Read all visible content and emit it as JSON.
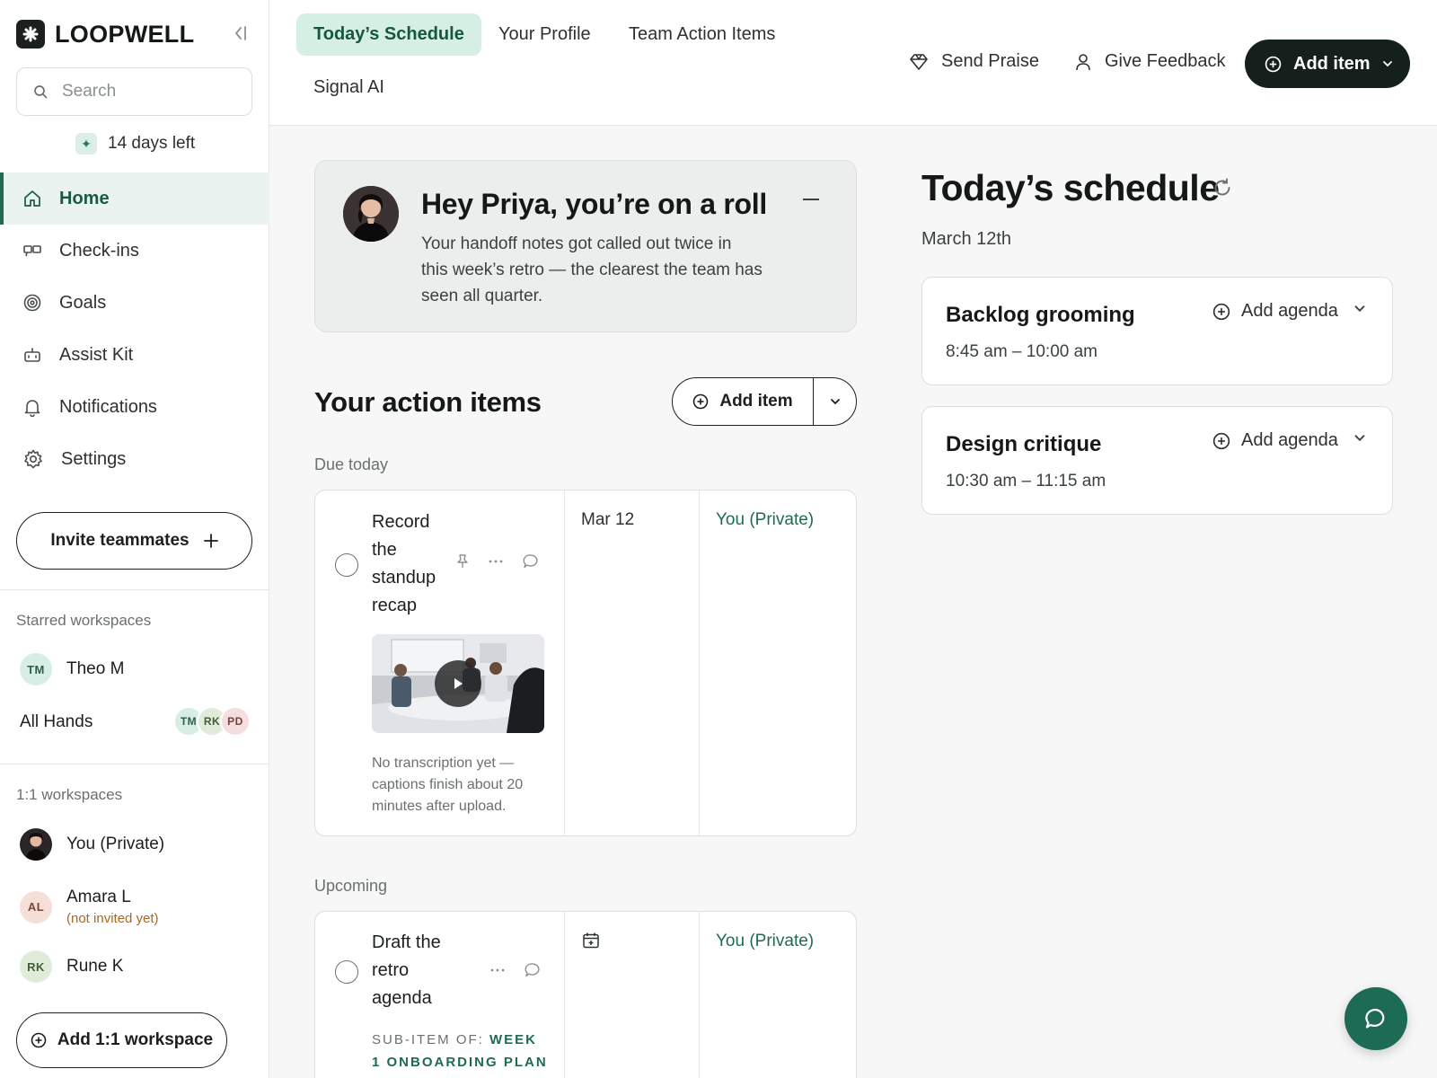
{
  "app": {
    "brand": "LOOPWELL",
    "trial": "14 days left",
    "accent": "#1f6b51",
    "fab_color": "#1e6b55"
  },
  "search": {
    "placeholder": "Search"
  },
  "sidebar": {
    "nav": [
      {
        "label": "Home",
        "icon": "home-icon",
        "active": true
      },
      {
        "label": "Check-ins",
        "icon": "check-ins-icon"
      },
      {
        "label": "Goals",
        "icon": "target-icon"
      },
      {
        "label": "Assist Kit",
        "icon": "robot-icon"
      },
      {
        "label": "Notifications",
        "icon": "bell-icon"
      },
      {
        "label": "Settings",
        "icon": "gear-icon"
      }
    ],
    "invite": "Invite teammates",
    "starred_label": "Starred workspaces",
    "starred": [
      {
        "name": "Theo M",
        "initials": "TM"
      },
      {
        "name": "All Hands",
        "members": [
          "TM",
          "RK",
          "PD"
        ]
      }
    ],
    "one_on_one_label": "1:1 workspaces",
    "one_on_one": [
      {
        "name": "You (Private)"
      },
      {
        "name": "Amara L",
        "initials": "AL",
        "note": "(not invited yet)"
      },
      {
        "name": "Rune K",
        "initials": "RK"
      }
    ],
    "add_workspace": "Add 1:1 workspace"
  },
  "topbar": {
    "tabs": [
      {
        "label": "Today’s Schedule",
        "active": true
      },
      {
        "label": "Your Profile"
      },
      {
        "label": "Team Action Items"
      },
      {
        "label": "Signal AI"
      }
    ],
    "send_praise": "Send Praise",
    "give_feedback": "Give Feedback",
    "add_item": "Add item"
  },
  "greeting": {
    "title": "Hey Priya, you’re on a roll",
    "body": "Your handoff notes got called out twice in this week’s retro — the clearest the team has seen all quarter."
  },
  "action_items": {
    "heading": "Your action items",
    "add_label": "Add item",
    "due_today_label": "Due today",
    "due_today": [
      {
        "title": "Record the standup recap",
        "date": "Mar 12",
        "owner": "You (Private)",
        "caption": "No transcription yet — captions finish about 20 minutes after upload."
      }
    ],
    "upcoming_label": "Upcoming",
    "upcoming": [
      {
        "title": "Draft the retro agenda",
        "owner": "You (Private)",
        "sub_item_prefix": "SUB-ITEM OF:",
        "sub_item_parent": "WEEK 1 ONBOARDING PLAN"
      }
    ]
  },
  "schedule": {
    "heading": "Today’s schedule",
    "date": "March 12th",
    "meetings": [
      {
        "title": "Backlog grooming",
        "time": "8:45 am – 10:00 am",
        "agenda": "Add agenda"
      },
      {
        "title": "Design critique",
        "time": "10:30 am – 11:15 am",
        "agenda": "Add agenda"
      }
    ]
  }
}
